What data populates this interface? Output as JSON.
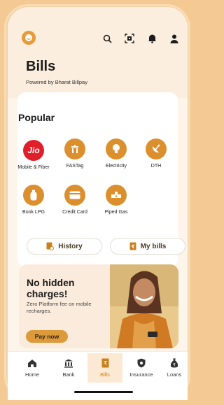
{
  "header": {
    "title": "Bills",
    "subtitle": "Powered by Bharat Billpay",
    "icons": [
      "profile-icon",
      "search-icon",
      "scan-icon",
      "bell-icon",
      "user-icon"
    ]
  },
  "popular": {
    "title": "Popular",
    "items": [
      {
        "label": "Mobile & Fiber",
        "icon": "jio-logo",
        "logo_text": "Jio"
      },
      {
        "label": "FASTag",
        "icon": "toll-booth-icon"
      },
      {
        "label": "Electricity",
        "icon": "bulb-icon"
      },
      {
        "label": "DTH",
        "icon": "satellite-dish-icon"
      },
      {
        "label": "Book LPG",
        "icon": "gas-cylinder-icon"
      },
      {
        "label": "Credit Card",
        "icon": "credit-card-icon"
      },
      {
        "label": "Piped Gas",
        "icon": "pipe-icon"
      }
    ]
  },
  "actions": {
    "history_label": "History",
    "my_bills_label": "My bills"
  },
  "banner": {
    "heading": "No hidden charges!",
    "text": "Zero Platform fee on mobile recharges.",
    "cta": "Pay now"
  },
  "nav": {
    "items": [
      {
        "label": "Home",
        "icon": "home-icon"
      },
      {
        "label": "Bank",
        "icon": "bank-icon"
      },
      {
        "label": "Bills",
        "icon": "bill-icon",
        "active": true
      },
      {
        "label": "Insurance",
        "icon": "shield-icon"
      },
      {
        "label": "Loans",
        "icon": "loan-bag-icon"
      }
    ]
  },
  "colors": {
    "accent": "#dc8f2d",
    "jio_red": "#e01f2a",
    "background": "#fdf4ea"
  }
}
